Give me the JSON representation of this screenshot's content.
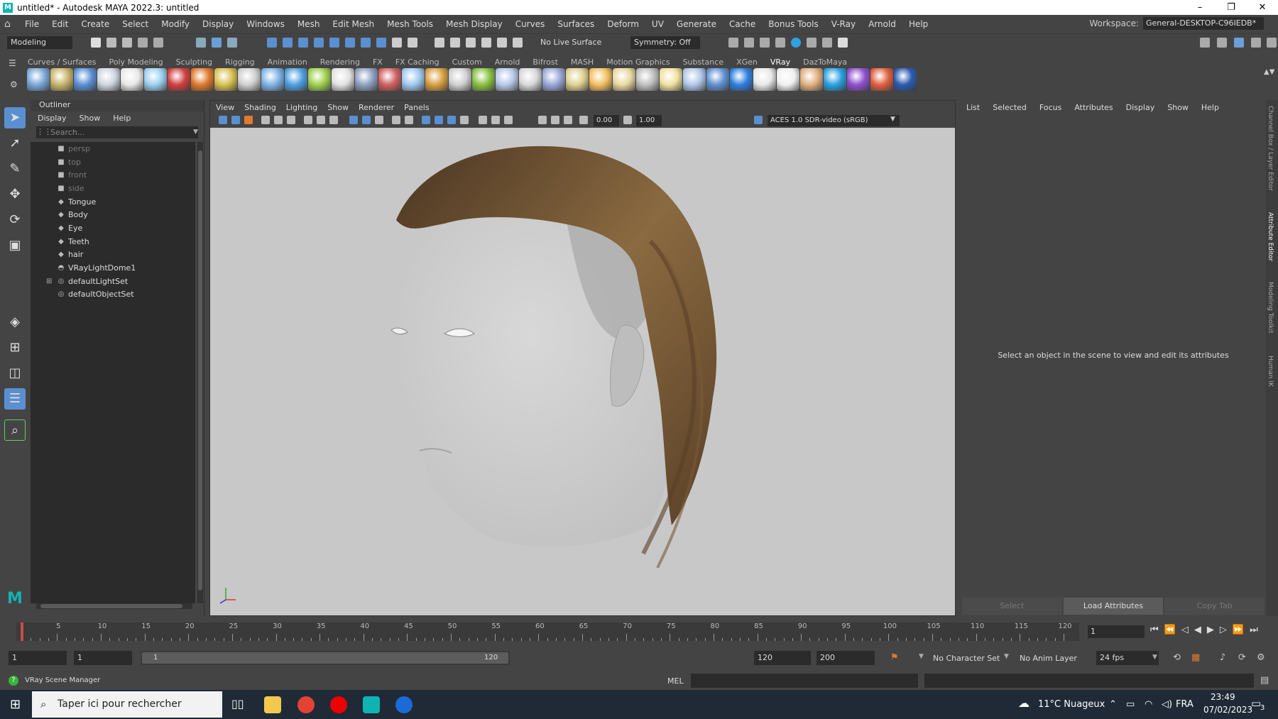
{
  "window": {
    "title": "untitled* - Autodesk MAYA 2022.3: untitled",
    "logo_letter": "M",
    "minimize": "–",
    "restore": "❐",
    "close": "✕"
  },
  "menubar": {
    "items": [
      "File",
      "Edit",
      "Create",
      "Select",
      "Modify",
      "Display",
      "Windows",
      "Mesh",
      "Edit Mesh",
      "Mesh Tools",
      "Mesh Display",
      "Curves",
      "Surfaces",
      "Deform",
      "UV",
      "Generate",
      "Cache",
      "Bonus Tools",
      "V-Ray",
      "Arnold",
      "Help"
    ],
    "workspace_label": "Workspace:",
    "workspace_value": "General-DESKTOP-C96IEDB*"
  },
  "statusline": {
    "menuset": "Modeling",
    "live_surface": "No Live Surface",
    "symmetry": "Symmetry: Off"
  },
  "shelf": {
    "tabs": [
      "Curves / Surfaces",
      "Poly Modeling",
      "Sculpting",
      "Rigging",
      "Animation",
      "Rendering",
      "FX",
      "FX Caching",
      "Custom",
      "Arnold",
      "Bifrost",
      "MASH",
      "Motion Graphics",
      "Substance",
      "XGen",
      "VRay",
      "DazToMaya"
    ],
    "active_tab": "VRay",
    "icon_colors": [
      "#7aa7d8",
      "#c9b36b",
      "#5b8fd6",
      "#cfd5df",
      "#e8e8e8",
      "#9ad0f0",
      "#d04040",
      "#e07a30",
      "#d8c050",
      "#cfcfcf",
      "#7fb4e6",
      "#4f9fe0",
      "#9fd050",
      "#e2e2e2",
      "#8fa0c0",
      "#d06060",
      "#a0c8f0",
      "#d8a040",
      "#d0d0d0",
      "#88c040",
      "#b8c8e8",
      "#d8d8d8",
      "#9aa8d8",
      "#e0d090",
      "#f2c060",
      "#e8d8a0",
      "#c0c0c0",
      "#f0e0a0",
      "#b0c8e8",
      "#6090d0",
      "#3080e0",
      "#e8e8e8",
      "#f0f0f0",
      "#e0b080",
      "#2aa0e0",
      "#9050d0",
      "#e06040",
      "#2a5ab0"
    ]
  },
  "toolbox": {
    "tools": [
      "select-tool",
      "lasso-tool",
      "paint-tool",
      "move-tool",
      "rotate-tool",
      "scale-tool"
    ]
  },
  "outliner": {
    "title": "Outliner",
    "menus": [
      "Display",
      "Show",
      "Help"
    ],
    "search_placeholder": "Search...",
    "nodes": [
      {
        "label": "persp",
        "icon": "camera",
        "dim": true
      },
      {
        "label": "top",
        "icon": "camera",
        "dim": true
      },
      {
        "label": "front",
        "icon": "camera",
        "dim": true
      },
      {
        "label": "side",
        "icon": "camera",
        "dim": true
      },
      {
        "label": "Tongue",
        "icon": "mesh",
        "dim": false
      },
      {
        "label": "Body",
        "icon": "mesh",
        "dim": false
      },
      {
        "label": "Eye",
        "icon": "mesh",
        "dim": false
      },
      {
        "label": "Teeth",
        "icon": "mesh",
        "dim": false
      },
      {
        "label": "hair",
        "icon": "mesh",
        "dim": false
      },
      {
        "label": "VRayLightDome1",
        "icon": "dome",
        "dim": false
      },
      {
        "label": "defaultLightSet",
        "icon": "set",
        "dim": false,
        "expand": true
      },
      {
        "label": "defaultObjectSet",
        "icon": "set",
        "dim": false
      }
    ]
  },
  "viewport": {
    "menus": [
      "View",
      "Shading",
      "Lighting",
      "Show",
      "Renderer",
      "Panels"
    ],
    "exposure": "0.00",
    "gamma": "1.00",
    "colorspace": "ACES 1.0 SDR-video (sRGB)"
  },
  "attribute_editor": {
    "menus": [
      "List",
      "Selected",
      "Focus",
      "Attributes",
      "Display",
      "Show",
      "Help"
    ],
    "message": "Select an object in the scene to view and edit its attributes",
    "buttons": [
      "Select",
      "Load Attributes",
      "Copy Tab"
    ]
  },
  "side_tabs": [
    "Channel Box / Layer Editor",
    "Attribute Editor",
    "Modeling Toolkit",
    "Human IK"
  ],
  "timeline": {
    "ticks": [
      "1",
      "5",
      "10",
      "15",
      "20",
      "25",
      "30",
      "35",
      "40",
      "45",
      "50",
      "55",
      "60",
      "65",
      "70",
      "75",
      "80",
      "85",
      "90",
      "95",
      "100",
      "105",
      "110",
      "115",
      "120"
    ],
    "current_frame": "1"
  },
  "range": {
    "start": "1",
    "anim_start": "1",
    "range_start": "1",
    "range_end": "120",
    "end": "120",
    "anim_end": "200",
    "character_set": "No Character Set",
    "anim_layer": "No Anim Layer",
    "fps": "24 fps"
  },
  "commandline": {
    "help_text": "VRay Scene Manager",
    "lang": "MEL"
  },
  "taskbar": {
    "search_placeholder": "Taper ici pour rechercher",
    "weather": "11°C Nuageux",
    "lang": "FRA",
    "time": "23:49",
    "date": "07/02/2023",
    "notifications": "3"
  }
}
